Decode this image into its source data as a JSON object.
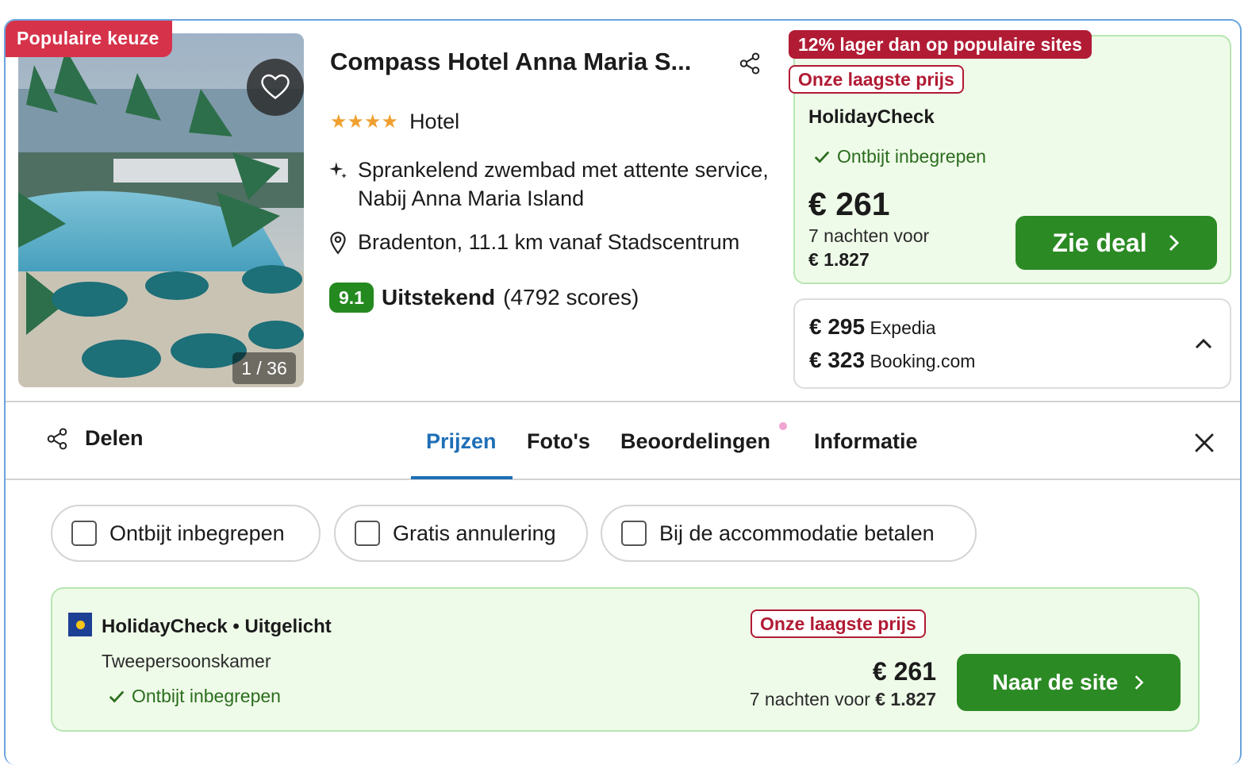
{
  "hotel": {
    "popular_label": "Populaire keuze",
    "photo_counter": "1 / 36",
    "name": "Compass Hotel Anna Maria S...",
    "stars": "★★★★",
    "star_count": 4,
    "type": "Hotel",
    "description": "Sprankelend zwembad met attente service, Nabij Anna Maria Island",
    "location": "Bradenton, 11.1 km vanaf Stadscentrum",
    "rating": {
      "score": "9.1",
      "label": "Uitstekend",
      "count": "(4792 scores)"
    }
  },
  "best_deal": {
    "lower_tag": "12% lager dan op populaire sites",
    "lowest_tag": "Onze laagste prijs",
    "provider": "HolidayCheck",
    "perk": "Ontbijt inbegrepen",
    "price": "€ 261",
    "nights_label": "7 nachten voor",
    "total": "€ 1.827",
    "button_label": "Zie deal"
  },
  "other_prices": [
    {
      "price": "€ 295",
      "provider": "Expedia"
    },
    {
      "price": "€ 323",
      "provider": "Booking.com"
    }
  ],
  "tabs_bar": {
    "share_label": "Delen",
    "tabs": [
      {
        "label": "Prijzen",
        "active": true
      },
      {
        "label": "Foto's",
        "active": false
      },
      {
        "label": "Beoordelingen",
        "active": false
      },
      {
        "label": "Informatie",
        "active": false
      }
    ]
  },
  "filters": [
    {
      "label": "Ontbijt inbegrepen",
      "checked": false
    },
    {
      "label": "Gratis annulering",
      "checked": false
    },
    {
      "label": "Bij de accommodatie betalen",
      "checked": false
    }
  ],
  "offer": {
    "title": "HolidayCheck • Uitgelicht",
    "room": "Tweepersoonskamer",
    "perk": "Ontbijt inbegrepen",
    "lowest_tag": "Onze laagste prijs",
    "price": "€ 261",
    "nights_label": "7 nachten voor",
    "total": "€ 1.827",
    "button_label": "Naar de site"
  },
  "colors": {
    "accent_blue": "#1f6fb6",
    "deal_green": "#2b8a24",
    "badge_red": "#d6334b",
    "tag_red": "#b11b34",
    "deal_bg": "#effbe9"
  },
  "icons": [
    "heart-icon",
    "share-icon",
    "sparkle-icon",
    "location-pin-icon",
    "check-icon",
    "chevron-right-icon",
    "chevron-up-icon",
    "close-icon"
  ]
}
